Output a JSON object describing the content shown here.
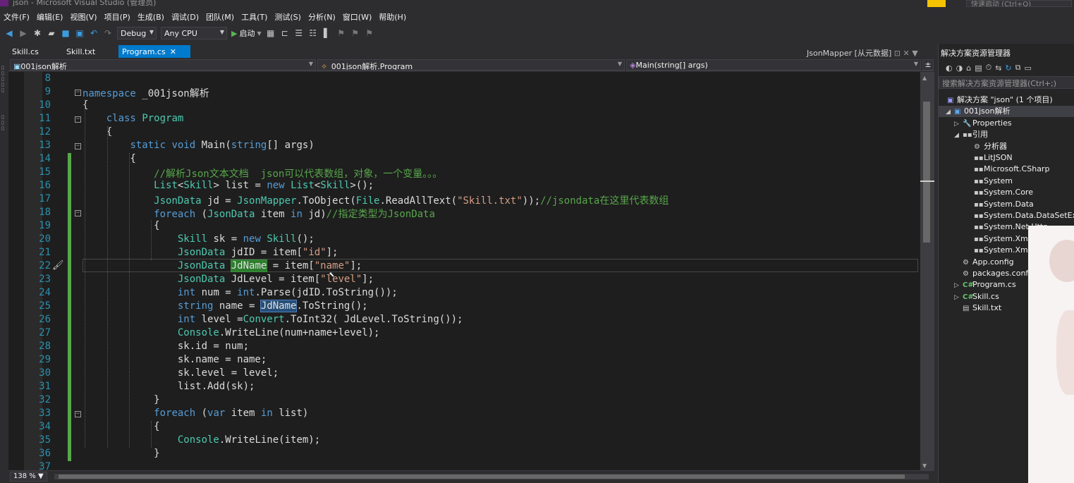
{
  "window": {
    "title": "json - Microsoft Visual Studio (管理员)",
    "quick_launch": "快速启动 (Ctrl+Q)"
  },
  "menu": [
    "文件(F)",
    "编辑(E)",
    "视图(V)",
    "项目(P)",
    "生成(B)",
    "调试(D)",
    "团队(M)",
    "工具(T)",
    "测试(S)",
    "分析(N)",
    "窗口(W)",
    "帮助(H)"
  ],
  "toolbar": {
    "config": "Debug",
    "platform": "Any CPU",
    "start": "启动"
  },
  "tabs": [
    {
      "label": "Skill.cs",
      "active": false
    },
    {
      "label": "Skill.txt",
      "active": false
    },
    {
      "label": "Program.cs",
      "active": true
    }
  ],
  "preview_tab": "JsonMapper [从元数据]",
  "nav": {
    "project": "001json解析",
    "class": "_001json解析.Program",
    "member": "Main(string[] args)"
  },
  "code": [
    {
      "n": "8",
      "t": ""
    },
    {
      "n": "9",
      "t": "namespace _001json解析"
    },
    {
      "n": "10",
      "t": "{"
    },
    {
      "n": "11",
      "t": "    class Program"
    },
    {
      "n": "12",
      "t": "    {"
    },
    {
      "n": "13",
      "t": "        static void Main(string[] args)"
    },
    {
      "n": "14",
      "t": "        {"
    },
    {
      "n": "15",
      "t": "            //解析Json文本文档  json可以代表数组，对象，一个变量。。。"
    },
    {
      "n": "16",
      "t": "            List<Skill> list = new List<Skill>();"
    },
    {
      "n": "17",
      "t": "            JsonData jd = JsonMapper.ToObject(File.ReadAllText(\"Skill.txt\"));//jsondata在这里代表数组"
    },
    {
      "n": "18",
      "t": "            foreach (JsonData item in jd)//指定类型为JsonData"
    },
    {
      "n": "19",
      "t": "            {"
    },
    {
      "n": "20",
      "t": "                Skill sk = new Skill();"
    },
    {
      "n": "21",
      "t": "                JsonData jdID = item[\"id\"];"
    },
    {
      "n": "22",
      "t": "                JsonData JdName = item[\"name\"];"
    },
    {
      "n": "23",
      "t": "                JsonData JdLevel = item[\"level\"];"
    },
    {
      "n": "24",
      "t": "                int num = int.Parse(jdID.ToString());"
    },
    {
      "n": "25",
      "t": "                string name = JdName.ToString();"
    },
    {
      "n": "26",
      "t": "                int level =Convert.ToInt32( JdLevel.ToString());"
    },
    {
      "n": "27",
      "t": "                Console.WriteLine(num+name+level);"
    },
    {
      "n": "28",
      "t": "                sk.id = num;"
    },
    {
      "n": "29",
      "t": "                sk.name = name;"
    },
    {
      "n": "30",
      "t": "                sk.level = level;"
    },
    {
      "n": "31",
      "t": "                list.Add(sk);"
    },
    {
      "n": "32",
      "t": "            }"
    },
    {
      "n": "33",
      "t": "            foreach (var item in list)"
    },
    {
      "n": "34",
      "t": "            {"
    },
    {
      "n": "35",
      "t": "                Console.WriteLine(item);"
    },
    {
      "n": "36",
      "t": "            }"
    },
    {
      "n": "37",
      "t": ""
    }
  ],
  "status": {
    "zoom": "138 %"
  },
  "solution_explorer": {
    "title": "解决方案资源管理器",
    "search_placeholder": "搜索解决方案资源管理器(Ctrl+;)",
    "solution": "解决方案 \"json\" (1 个项目)",
    "project": "001json解析",
    "items": [
      {
        "label": "Properties",
        "depth": 2,
        "icon": "wrench-icon",
        "expander": "▷"
      },
      {
        "label": "引用",
        "depth": 2,
        "icon": "references-icon",
        "expander": "◢"
      },
      {
        "label": "分析器",
        "depth": 3,
        "icon": "analyzer-icon",
        "expander": ""
      },
      {
        "label": "LitJSON",
        "depth": 3,
        "icon": "reference-icon",
        "expander": ""
      },
      {
        "label": "Microsoft.CSharp",
        "depth": 3,
        "icon": "reference-icon",
        "expander": ""
      },
      {
        "label": "System",
        "depth": 3,
        "icon": "reference-icon",
        "expander": ""
      },
      {
        "label": "System.Core",
        "depth": 3,
        "icon": "reference-icon",
        "expander": ""
      },
      {
        "label": "System.Data",
        "depth": 3,
        "icon": "reference-icon",
        "expander": ""
      },
      {
        "label": "System.Data.DataSetExte",
        "depth": 3,
        "icon": "reference-icon",
        "expander": ""
      },
      {
        "label": "System.Net.Http",
        "depth": 3,
        "icon": "reference-icon",
        "expander": ""
      },
      {
        "label": "System.Xml",
        "depth": 3,
        "icon": "reference-icon",
        "expander": ""
      },
      {
        "label": "System.Xml",
        "depth": 3,
        "icon": "reference-icon",
        "expander": ""
      },
      {
        "label": "App.config",
        "depth": 2,
        "icon": "config-icon",
        "expander": ""
      },
      {
        "label": "packages.config",
        "depth": 2,
        "icon": "config-icon",
        "expander": ""
      },
      {
        "label": "Program.cs",
        "depth": 2,
        "icon": "csharp-file-icon",
        "expander": "▷"
      },
      {
        "label": "Skill.cs",
        "depth": 2,
        "icon": "csharp-file-icon",
        "expander": "▷"
      },
      {
        "label": "Skill.txt",
        "depth": 2,
        "icon": "text-file-icon",
        "expander": ""
      }
    ]
  },
  "colors": {
    "accent": "#007acc",
    "keyword": "#569cd6",
    "type": "#4ec9b0",
    "string": "#d69d85",
    "comment": "#57a64a",
    "line_number": "#2b91af",
    "editor_bg": "#1e1e1e"
  }
}
